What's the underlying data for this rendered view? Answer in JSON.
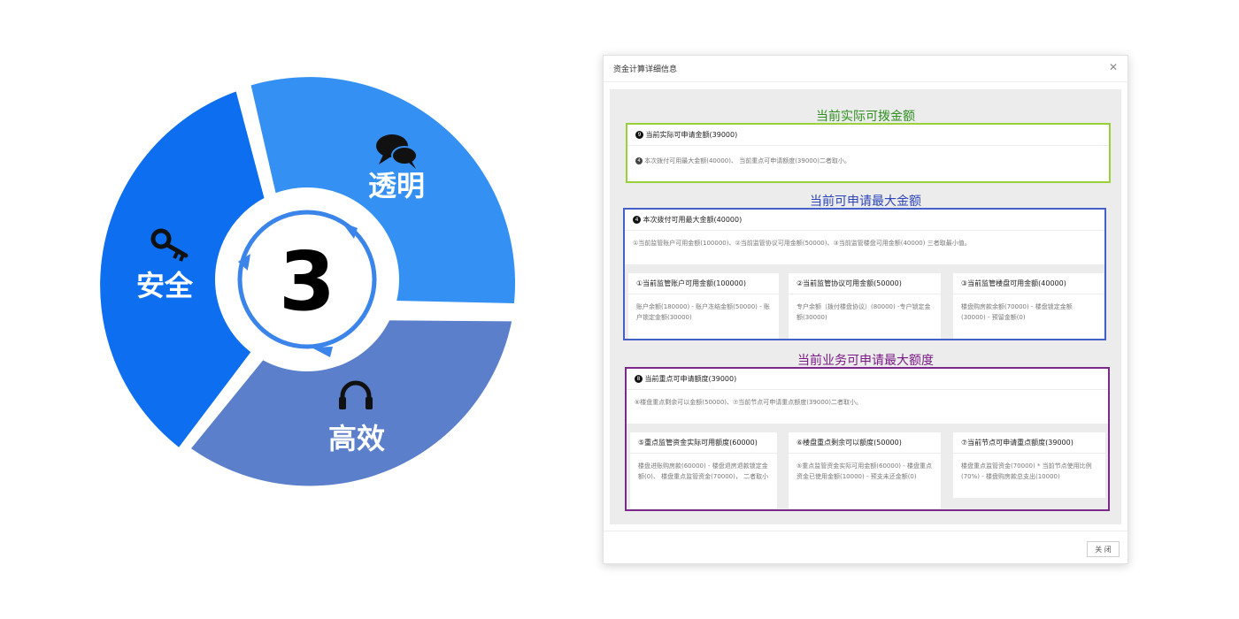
{
  "diagram": {
    "center_number": "3",
    "segments": [
      {
        "label": "透明",
        "icon": "chat-bubbles-icon",
        "color": "#3590f3"
      },
      {
        "label": "高效",
        "icon": "headphones-icon",
        "color": "#5b7fcb"
      },
      {
        "label": "安全",
        "icon": "key-icon",
        "color": "#0d6ff0"
      }
    ]
  },
  "dialog": {
    "title": "资金计算详细信息",
    "close_button": "关 闭",
    "sections": [
      {
        "title": "当前实际可拨金额",
        "title_color": "#2f8f1e",
        "border_color": "#9ad13a",
        "main": {
          "heading": "当前实际可申请金额(39000)",
          "body": "本次拨付可用最大金额(40000)、 当前重点可申请额度(39000)二者取小。"
        }
      },
      {
        "title": "当前可申请最大金额",
        "title_color": "#2d45b8",
        "border_color": "#4560c8",
        "main": {
          "heading": "本次拨付可用最大金额(40000)",
          "body": "①当前监管账户可用金额(100000)、②当前监管协议可用金额(50000)、③当前监管楼盘可用金额(40000) 三者取最小值。"
        },
        "subs": [
          {
            "heading": "①当前监管账户可用金额(100000)",
            "body": "账户余额(180000) - 账户冻结金额(50000) - 账户锁定金额(30000)"
          },
          {
            "heading": "②当前监管协议可用金额(50000)",
            "body": "专户余额（拨付楼盘协议）(80000) -专户锁定金额(30000)"
          },
          {
            "heading": "③当前监管楼盘可用金额(40000)",
            "body": "楼盘购房款余额(70000) - 楼盘锁定金额(30000) - 预留金额(0)"
          }
        ]
      },
      {
        "title": "当前业务可申请最大额度",
        "title_color": "#7a1a86",
        "border_color": "#7b2a8b",
        "main": {
          "heading": "当前重点可申请额度(39000)",
          "body": "⑥楼盘重点剩余可以金额(50000)、⑦当前节点可申请重点额度(39000)二者取小。"
        },
        "subs": [
          {
            "heading": "⑤重点监管资金实际可用额度(60000)",
            "body": "楼盘进账购房款(60000) - 楼盘退房退款锁定金额(0)、 楼盘重点监管资金(70000)， 二者取小"
          },
          {
            "heading": "⑥楼盘重点剩余可以额度(50000)",
            "body": "⑤重点监管资金实际可用金额(60000) - 楼盘重点资金已使用金额(10000) - 预支未还金额(0)"
          },
          {
            "heading": "⑦当前节点可申请重点额度(39000)",
            "body": "楼盘重点监管资金(70000) * 当前节点使用比例(70%) - 楼盘购房款总支出(10000)"
          }
        ]
      }
    ],
    "badges": {
      "n9": "9",
      "n4": "4",
      "n8": "8"
    }
  }
}
